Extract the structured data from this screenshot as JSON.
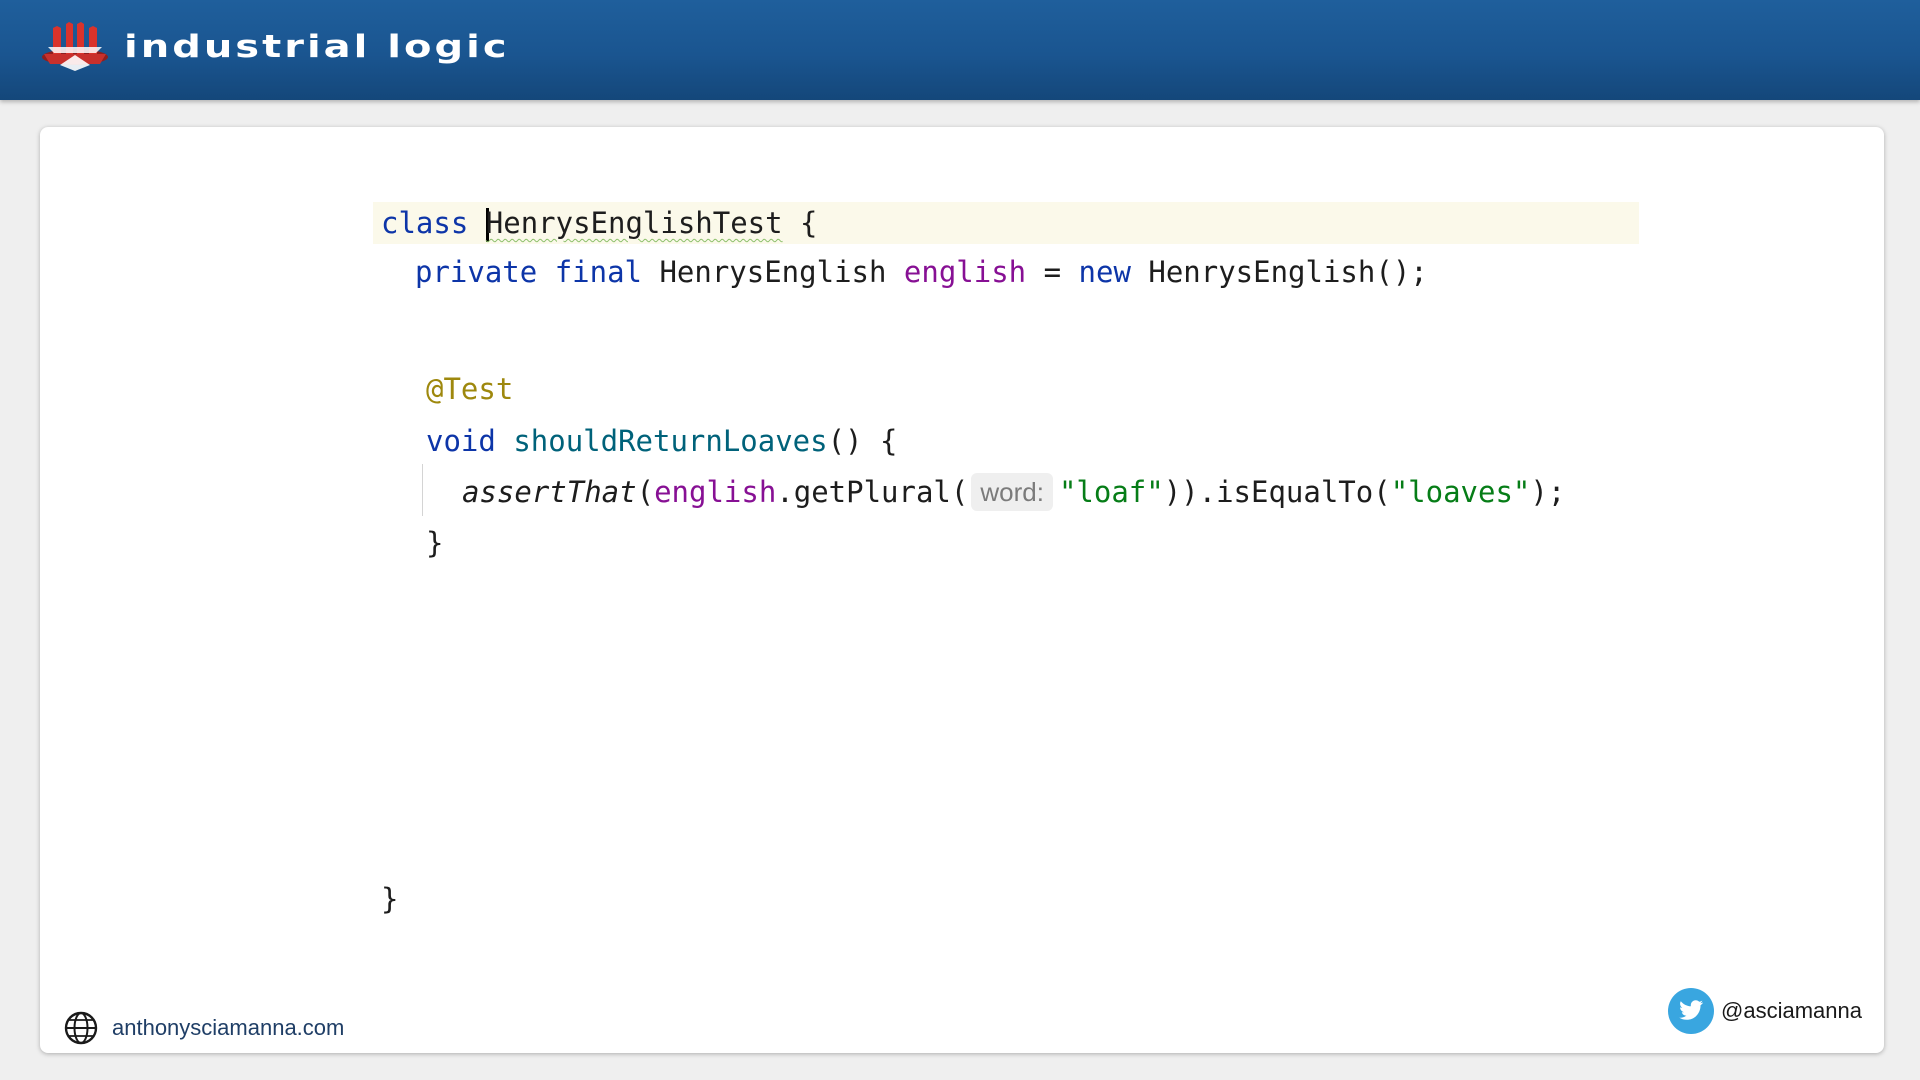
{
  "header": {
    "brand_text": "industrial logic",
    "brand_color": "#1a5590",
    "logo_icon": "industrial-logic-logo"
  },
  "code": {
    "colors": {
      "keyword": "#0d35a8",
      "field": "#871094",
      "annotation": "#9e880d",
      "method_declaration": "#00627a",
      "string": "#067d17",
      "current_line": "#fbf9ea"
    },
    "line1": {
      "keyword_class": "class",
      "class_name": "HenrysEnglishTest",
      "brace": " {"
    },
    "line2": {
      "private": "private",
      "final": "final",
      "type": "HenrysEnglish",
      "field": "english",
      "equals": " = ",
      "new": "new",
      "ctor": " HenrysEnglish();"
    },
    "line3": {
      "annotation": "@Test"
    },
    "line4": {
      "void": "void",
      "method": "shouldReturnLoaves",
      "rest": "() {"
    },
    "line5": {
      "assert": "assertThat",
      "open": "(",
      "field": "english",
      "call": ".getPlural(",
      "hint": "word:",
      "arg": "\"loaf\"",
      "chain": ")).isEqualTo(",
      "expected": "\"loaves\"",
      "end": ");"
    },
    "line6": {
      "brace": "}"
    },
    "line7": {
      "brace": "}"
    }
  },
  "footer": {
    "website": "anthonysciamanna.com",
    "website_icon": "globe-icon",
    "twitter_handle": "@asciamanna",
    "twitter_icon": "twitter-bird-icon",
    "twitter_color": "#39a6e0"
  }
}
